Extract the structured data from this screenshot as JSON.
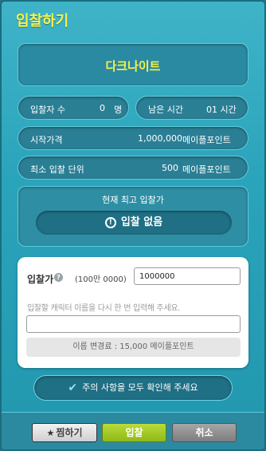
{
  "window": {
    "title": "입찰하기"
  },
  "item": {
    "name": "다크나이트"
  },
  "stats": {
    "bidders_label": "입찰자 수",
    "bidders_value": "0",
    "bidders_unit": "명",
    "time_left_label": "남은 시간",
    "time_left_value": "01 시간",
    "start_price_label": "시작가격",
    "start_price_value": "1,000,000",
    "start_price_unit": "메이플포인트",
    "min_increment_label": "최소 입찰 단위",
    "min_increment_value": "500",
    "min_increment_unit": "메이플포인트"
  },
  "current_bid": {
    "label": "현재 최고 입찰가",
    "status": "입찰 없음",
    "icon": "exclamation-circle-icon"
  },
  "bid_form": {
    "bid_label": "입찰가",
    "help_icon": "question-icon",
    "bid_hint": "(100만 0000)",
    "bid_value": "1000000",
    "retype_label": "입찰할 캐릭터 이름을 다시 한 번 입력해 주세요.",
    "name_value": "",
    "fee_text": "이름 변경료 : 15,000 메이플포인트"
  },
  "confirm": {
    "label": "주의 사항을 모두 확인해 주세요",
    "icon": "check-icon"
  },
  "buttons": {
    "favorite": "찜하기",
    "favorite_icon": "star-icon",
    "bid": "입찰",
    "cancel": "취소"
  },
  "colors": {
    "title": "#f6f24a",
    "item_name": "#f6f24a",
    "bid_button": "#a3c92a",
    "cancel_button": "#8e8e8e",
    "background": "#2aa4bb"
  }
}
